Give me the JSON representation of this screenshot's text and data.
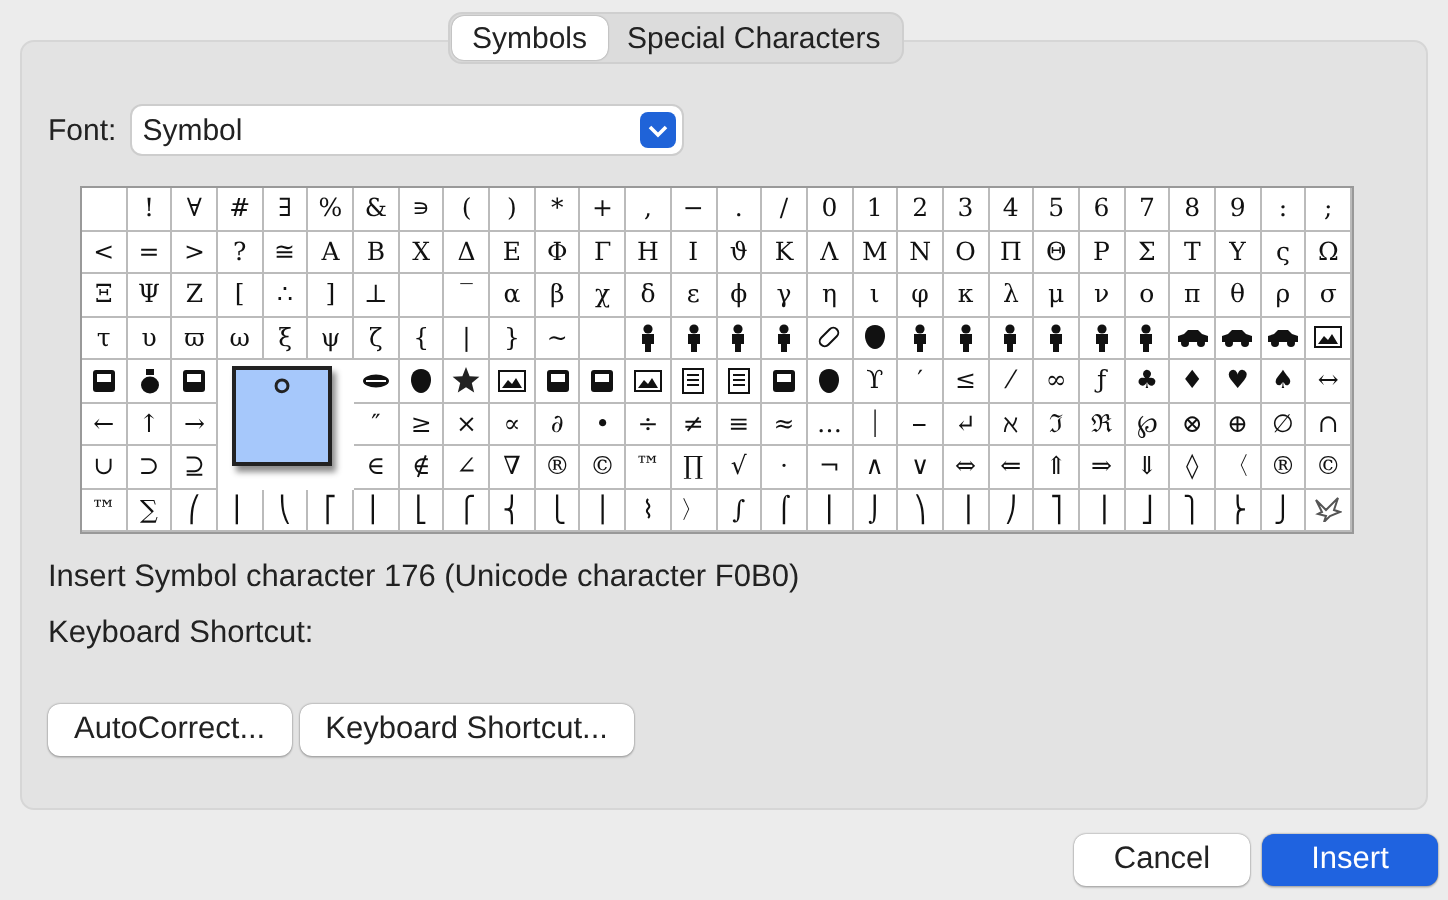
{
  "tabs": [
    {
      "label": "Symbols",
      "selected": true
    },
    {
      "label": "Special Characters",
      "selected": false
    }
  ],
  "font": {
    "label": "Font:",
    "value": "Symbol"
  },
  "grid": {
    "rows": [
      [
        {
          "kind": "blank"
        },
        {
          "kind": "char",
          "text": "!"
        },
        {
          "kind": "char",
          "text": "∀"
        },
        {
          "kind": "char",
          "text": "#"
        },
        {
          "kind": "char",
          "text": "∃"
        },
        {
          "kind": "char",
          "text": "%"
        },
        {
          "kind": "char",
          "text": "&"
        },
        {
          "kind": "char",
          "text": "∍"
        },
        {
          "kind": "char",
          "text": "("
        },
        {
          "kind": "char",
          "text": ")"
        },
        {
          "kind": "char",
          "text": "*"
        },
        {
          "kind": "char",
          "text": "+"
        },
        {
          "kind": "char",
          "text": ","
        },
        {
          "kind": "char",
          "text": "−"
        },
        {
          "kind": "char",
          "text": "."
        },
        {
          "kind": "char",
          "text": "/"
        },
        {
          "kind": "char",
          "text": "0"
        },
        {
          "kind": "char",
          "text": "1"
        },
        {
          "kind": "char",
          "text": "2"
        },
        {
          "kind": "char",
          "text": "3"
        },
        {
          "kind": "char",
          "text": "4"
        },
        {
          "kind": "char",
          "text": "5"
        },
        {
          "kind": "char",
          "text": "6"
        },
        {
          "kind": "char",
          "text": "7"
        },
        {
          "kind": "char",
          "text": "8"
        },
        {
          "kind": "char",
          "text": "9"
        },
        {
          "kind": "char",
          "text": ":"
        },
        {
          "kind": "char",
          "text": ";"
        }
      ],
      [
        {
          "kind": "char",
          "text": "<"
        },
        {
          "kind": "char",
          "text": "="
        },
        {
          "kind": "char",
          "text": ">"
        },
        {
          "kind": "char",
          "text": "?"
        },
        {
          "kind": "char",
          "text": "≅"
        },
        {
          "kind": "char",
          "text": "Α"
        },
        {
          "kind": "char",
          "text": "Β"
        },
        {
          "kind": "char",
          "text": "Χ"
        },
        {
          "kind": "char",
          "text": "Δ"
        },
        {
          "kind": "char",
          "text": "Ε"
        },
        {
          "kind": "char",
          "text": "Φ"
        },
        {
          "kind": "char",
          "text": "Γ"
        },
        {
          "kind": "char",
          "text": "Η"
        },
        {
          "kind": "char",
          "text": "Ι"
        },
        {
          "kind": "char",
          "text": "ϑ"
        },
        {
          "kind": "char",
          "text": "Κ"
        },
        {
          "kind": "char",
          "text": "Λ"
        },
        {
          "kind": "char",
          "text": "Μ"
        },
        {
          "kind": "char",
          "text": "Ν"
        },
        {
          "kind": "char",
          "text": "Ο"
        },
        {
          "kind": "char",
          "text": "Π"
        },
        {
          "kind": "char",
          "text": "Θ"
        },
        {
          "kind": "char",
          "text": "Ρ"
        },
        {
          "kind": "char",
          "text": "Σ"
        },
        {
          "kind": "char",
          "text": "Τ"
        },
        {
          "kind": "char",
          "text": "Υ"
        },
        {
          "kind": "char",
          "text": "ς"
        },
        {
          "kind": "char",
          "text": "Ω"
        }
      ],
      [
        {
          "kind": "char",
          "text": "Ξ"
        },
        {
          "kind": "char",
          "text": "Ψ"
        },
        {
          "kind": "char",
          "text": "Ζ"
        },
        {
          "kind": "char",
          "text": "["
        },
        {
          "kind": "char",
          "text": "∴"
        },
        {
          "kind": "char",
          "text": "]"
        },
        {
          "kind": "char",
          "text": "⊥"
        },
        {
          "kind": "blank"
        },
        {
          "kind": "char",
          "text": "‾"
        },
        {
          "kind": "char",
          "text": "α"
        },
        {
          "kind": "char",
          "text": "β"
        },
        {
          "kind": "char",
          "text": "χ"
        },
        {
          "kind": "char",
          "text": "δ"
        },
        {
          "kind": "char",
          "text": "ε"
        },
        {
          "kind": "char",
          "text": "ϕ"
        },
        {
          "kind": "char",
          "text": "γ"
        },
        {
          "kind": "char",
          "text": "η"
        },
        {
          "kind": "char",
          "text": "ι"
        },
        {
          "kind": "char",
          "text": "φ"
        },
        {
          "kind": "char",
          "text": "κ"
        },
        {
          "kind": "char",
          "text": "λ"
        },
        {
          "kind": "char",
          "text": "μ"
        },
        {
          "kind": "char",
          "text": "ν"
        },
        {
          "kind": "char",
          "text": "ο"
        },
        {
          "kind": "char",
          "text": "π"
        },
        {
          "kind": "char",
          "text": "θ"
        },
        {
          "kind": "char",
          "text": "ρ"
        },
        {
          "kind": "char",
          "text": "σ"
        }
      ],
      [
        {
          "kind": "char",
          "text": "τ"
        },
        {
          "kind": "char",
          "text": "υ"
        },
        {
          "kind": "char",
          "text": "ϖ"
        },
        {
          "kind": "char",
          "text": "ω"
        },
        {
          "kind": "char",
          "text": "ξ"
        },
        {
          "kind": "char",
          "text": "ψ"
        },
        {
          "kind": "char",
          "text": "ζ"
        },
        {
          "kind": "char",
          "text": "{"
        },
        {
          "kind": "char",
          "text": "|"
        },
        {
          "kind": "char",
          "text": "}"
        },
        {
          "kind": "char",
          "text": "~"
        },
        {
          "kind": "blank"
        },
        {
          "kind": "icon"
        },
        {
          "kind": "icon"
        },
        {
          "kind": "icon"
        },
        {
          "kind": "icon"
        },
        {
          "kind": "icon"
        },
        {
          "kind": "icon"
        },
        {
          "kind": "icon"
        },
        {
          "kind": "icon"
        },
        {
          "kind": "icon"
        },
        {
          "kind": "icon"
        },
        {
          "kind": "icon"
        },
        {
          "kind": "icon"
        },
        {
          "kind": "icon"
        },
        {
          "kind": "icon"
        },
        {
          "kind": "icon"
        },
        {
          "kind": "icon"
        }
      ],
      [
        {
          "kind": "icon"
        },
        {
          "kind": "icon"
        },
        {
          "kind": "icon"
        },
        {
          "kind": "covered"
        },
        {
          "kind": "covered"
        },
        {
          "kind": "covered"
        },
        {
          "kind": "icon"
        },
        {
          "kind": "icon"
        },
        {
          "kind": "icon"
        },
        {
          "kind": "icon"
        },
        {
          "kind": "icon"
        },
        {
          "kind": "icon"
        },
        {
          "kind": "icon"
        },
        {
          "kind": "icon"
        },
        {
          "kind": "icon"
        },
        {
          "kind": "icon"
        },
        {
          "kind": "icon"
        },
        {
          "kind": "char",
          "text": "ϒ"
        },
        {
          "kind": "char",
          "text": "′"
        },
        {
          "kind": "char",
          "text": "≤"
        },
        {
          "kind": "char",
          "text": "⁄"
        },
        {
          "kind": "char",
          "text": "∞"
        },
        {
          "kind": "char",
          "text": "ƒ"
        },
        {
          "kind": "char",
          "text": "♣"
        },
        {
          "kind": "char",
          "text": "♦"
        },
        {
          "kind": "char",
          "text": "♥"
        },
        {
          "kind": "char",
          "text": "♠"
        },
        {
          "kind": "char",
          "text": "↔"
        }
      ],
      [
        {
          "kind": "char",
          "text": "←"
        },
        {
          "kind": "char",
          "text": "↑"
        },
        {
          "kind": "char",
          "text": "→"
        },
        {
          "kind": "covered"
        },
        {
          "kind": "covered"
        },
        {
          "kind": "covered"
        },
        {
          "kind": "char",
          "text": "″"
        },
        {
          "kind": "char",
          "text": "≥"
        },
        {
          "kind": "char",
          "text": "×"
        },
        {
          "kind": "char",
          "text": "∝"
        },
        {
          "kind": "char",
          "text": "∂"
        },
        {
          "kind": "char",
          "text": "•"
        },
        {
          "kind": "char",
          "text": "÷"
        },
        {
          "kind": "char",
          "text": "≠"
        },
        {
          "kind": "char",
          "text": "≡"
        },
        {
          "kind": "char",
          "text": "≈"
        },
        {
          "kind": "char",
          "text": "…"
        },
        {
          "kind": "char",
          "text": "⏐"
        },
        {
          "kind": "char",
          "text": "⎯"
        },
        {
          "kind": "char",
          "text": "↵"
        },
        {
          "kind": "char",
          "text": "ℵ"
        },
        {
          "kind": "char",
          "text": "ℑ"
        },
        {
          "kind": "char",
          "text": "ℜ"
        },
        {
          "kind": "char",
          "text": "℘"
        },
        {
          "kind": "char",
          "text": "⊗"
        },
        {
          "kind": "char",
          "text": "⊕"
        },
        {
          "kind": "char",
          "text": "∅"
        },
        {
          "kind": "char",
          "text": "∩"
        }
      ],
      [
        {
          "kind": "char",
          "text": "∪"
        },
        {
          "kind": "char",
          "text": "⊃"
        },
        {
          "kind": "char",
          "text": "⊇"
        },
        {
          "kind": "covered"
        },
        {
          "kind": "covered"
        },
        {
          "kind": "covered"
        },
        {
          "kind": "char",
          "text": "∈"
        },
        {
          "kind": "char",
          "text": "∉"
        },
        {
          "kind": "char",
          "text": "∠"
        },
        {
          "kind": "char",
          "text": "∇"
        },
        {
          "kind": "char",
          "text": "®"
        },
        {
          "kind": "char",
          "text": "©"
        },
        {
          "kind": "char",
          "text": "™"
        },
        {
          "kind": "char",
          "text": "∏"
        },
        {
          "kind": "char",
          "text": "√"
        },
        {
          "kind": "char",
          "text": "⋅"
        },
        {
          "kind": "char",
          "text": "¬"
        },
        {
          "kind": "char",
          "text": "∧"
        },
        {
          "kind": "char",
          "text": "∨"
        },
        {
          "kind": "char",
          "text": "⇔"
        },
        {
          "kind": "char",
          "text": "⇐"
        },
        {
          "kind": "char",
          "text": "⇑"
        },
        {
          "kind": "char",
          "text": "⇒"
        },
        {
          "kind": "char",
          "text": "⇓"
        },
        {
          "kind": "char",
          "text": "◊"
        },
        {
          "kind": "char",
          "text": "〈"
        },
        {
          "kind": "char",
          "text": "®"
        },
        {
          "kind": "char",
          "text": "©"
        }
      ],
      [
        {
          "kind": "char",
          "text": "™"
        },
        {
          "kind": "char",
          "text": "∑"
        },
        {
          "kind": "char",
          "text": "⎛"
        },
        {
          "kind": "char",
          "text": "⎜"
        },
        {
          "kind": "char",
          "text": "⎝"
        },
        {
          "kind": "char",
          "text": "⎡"
        },
        {
          "kind": "char",
          "text": "⎢"
        },
        {
          "kind": "char",
          "text": "⎣"
        },
        {
          "kind": "char",
          "text": "⎧"
        },
        {
          "kind": "char",
          "text": "⎨"
        },
        {
          "kind": "char",
          "text": "⎩"
        },
        {
          "kind": "char",
          "text": "⎪"
        },
        {
          "kind": "char",
          "text": "⌇"
        },
        {
          "kind": "char",
          "text": "〉"
        },
        {
          "kind": "char",
          "text": "∫"
        },
        {
          "kind": "char",
          "text": "⌠"
        },
        {
          "kind": "char",
          "text": "⎮"
        },
        {
          "kind": "char",
          "text": "⌡"
        },
        {
          "kind": "char",
          "text": "⎞"
        },
        {
          "kind": "char",
          "text": "⎟"
        },
        {
          "kind": "char",
          "text": "⎠"
        },
        {
          "kind": "char",
          "text": "⎤"
        },
        {
          "kind": "char",
          "text": "⎥"
        },
        {
          "kind": "char",
          "text": "⎦"
        },
        {
          "kind": "char",
          "text": "⎫"
        },
        {
          "kind": "char",
          "text": "⎬"
        },
        {
          "kind": "char",
          "text": "⎭"
        },
        {
          "kind": "icon"
        }
      ]
    ],
    "preview": {
      "character": "°"
    }
  },
  "info": "Insert Symbol character 176  (Unicode character F0B0)",
  "shortcut_label": "Keyboard Shortcut:",
  "buttons": [
    "AutoCorrect...",
    "Keyboard Shortcut..."
  ],
  "dialog_buttons": [
    {
      "label": "Cancel",
      "kind": "secondary"
    },
    {
      "label": "Insert",
      "kind": "primary"
    }
  ]
}
